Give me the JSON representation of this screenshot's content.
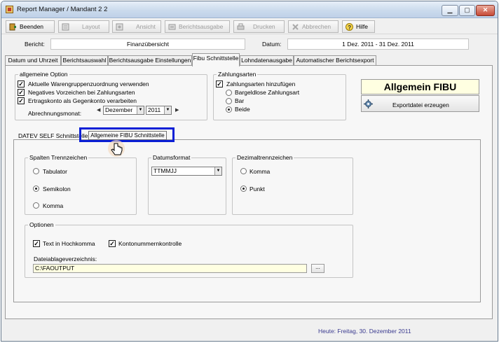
{
  "window": {
    "title": "Report Manager / Mandant 2 2",
    "controls": [
      "minimize",
      "maximize",
      "close"
    ]
  },
  "toolbar": {
    "buttons": [
      {
        "label": "Beenden",
        "icon": "exit-door-icon",
        "enabled": true
      },
      {
        "label": "Layout",
        "icon": "layout-icon",
        "enabled": false
      },
      {
        "label": "Ansicht",
        "icon": "view-icon",
        "enabled": false
      },
      {
        "label": "Berichtsausgabe",
        "icon": "report-output-icon",
        "enabled": false
      },
      {
        "label": "Drucken",
        "icon": "printer-icon",
        "enabled": false
      },
      {
        "label": "Abbrechen",
        "icon": "cancel-icon",
        "enabled": false
      },
      {
        "label": "Hilfe",
        "icon": "help-icon",
        "enabled": true
      }
    ]
  },
  "header": {
    "bericht_label": "Bericht:",
    "bericht_value": "Finanzübersicht",
    "datum_label": "Datum:",
    "datum_value": "1 Dez. 2011  -  31 Dez. 2011"
  },
  "tabs": [
    {
      "label": "Datum und Uhrzeit",
      "active": false
    },
    {
      "label": "Berichtsauswahl",
      "active": false
    },
    {
      "label": "Berichtsausgabe Einstellungen",
      "active": false
    },
    {
      "label": "Fibu Schnittstelle",
      "active": true
    },
    {
      "label": "Lohndatenausgabe",
      "active": false
    },
    {
      "label": "Automatischer Berichtsexport",
      "active": false
    }
  ],
  "allgemeine_option": {
    "title": "allgemeine Option",
    "checks": [
      {
        "label": "Aktuelle Warengruppenzuordnung verwenden",
        "checked": true
      },
      {
        "label": "Negatives Vorzeichen bei Zahlungsarten",
        "checked": true
      },
      {
        "label": "Ertragskonto als Gegenkonto verarbeiten",
        "checked": true
      }
    ],
    "abrechnungsmonat_label": "Abrechnungsmonat:",
    "month_value": "Dezember",
    "year_value": "2011"
  },
  "zahlungsarten": {
    "title": "Zahlungsarten",
    "add_check": {
      "label": "Zahlungsarten hinzufügen",
      "checked": true
    },
    "options": [
      {
        "label": "Bargeldlose Zahlungsart",
        "selected": false
      },
      {
        "label": "Bar",
        "selected": false
      },
      {
        "label": "Beide",
        "selected": true
      }
    ]
  },
  "right_panel": {
    "banner": "Allgemein FIBU",
    "export_button": "Exportdatei erzeugen"
  },
  "datev": {
    "label": "DATEV SELF Schnittstelle",
    "tab_label": "Allgemeine FIBU Schnittstelle"
  },
  "spalten": {
    "title": "Spalten Trennzeichen",
    "options": [
      {
        "label": "Tabulator",
        "selected": false
      },
      {
        "label": "Semikolon",
        "selected": true
      },
      {
        "label": "Komma",
        "selected": false
      }
    ]
  },
  "datumsformat": {
    "title": "Datumsformat",
    "value": "TTMMJJ"
  },
  "dezimal": {
    "title": "Dezimaltrennzeichen",
    "options": [
      {
        "label": "Komma",
        "selected": false
      },
      {
        "label": "Punkt",
        "selected": true
      }
    ]
  },
  "optionen": {
    "title": "Optionen",
    "text_hochkomma": {
      "label": "Text in Hochkomma",
      "checked": true
    },
    "kontonummern": {
      "label": "Kontonummernkontrolle",
      "checked": true
    },
    "dir_label": "Dateiablageverzeichnis:",
    "dir_value": "C:\\FAOUTPUT",
    "browse_label": "..."
  },
  "status": {
    "text": "Heute: Freitag, 30. Dezember 2011"
  },
  "colors": {
    "highlight": "#0a1fd6",
    "banner_bg": "#ffffe1"
  }
}
